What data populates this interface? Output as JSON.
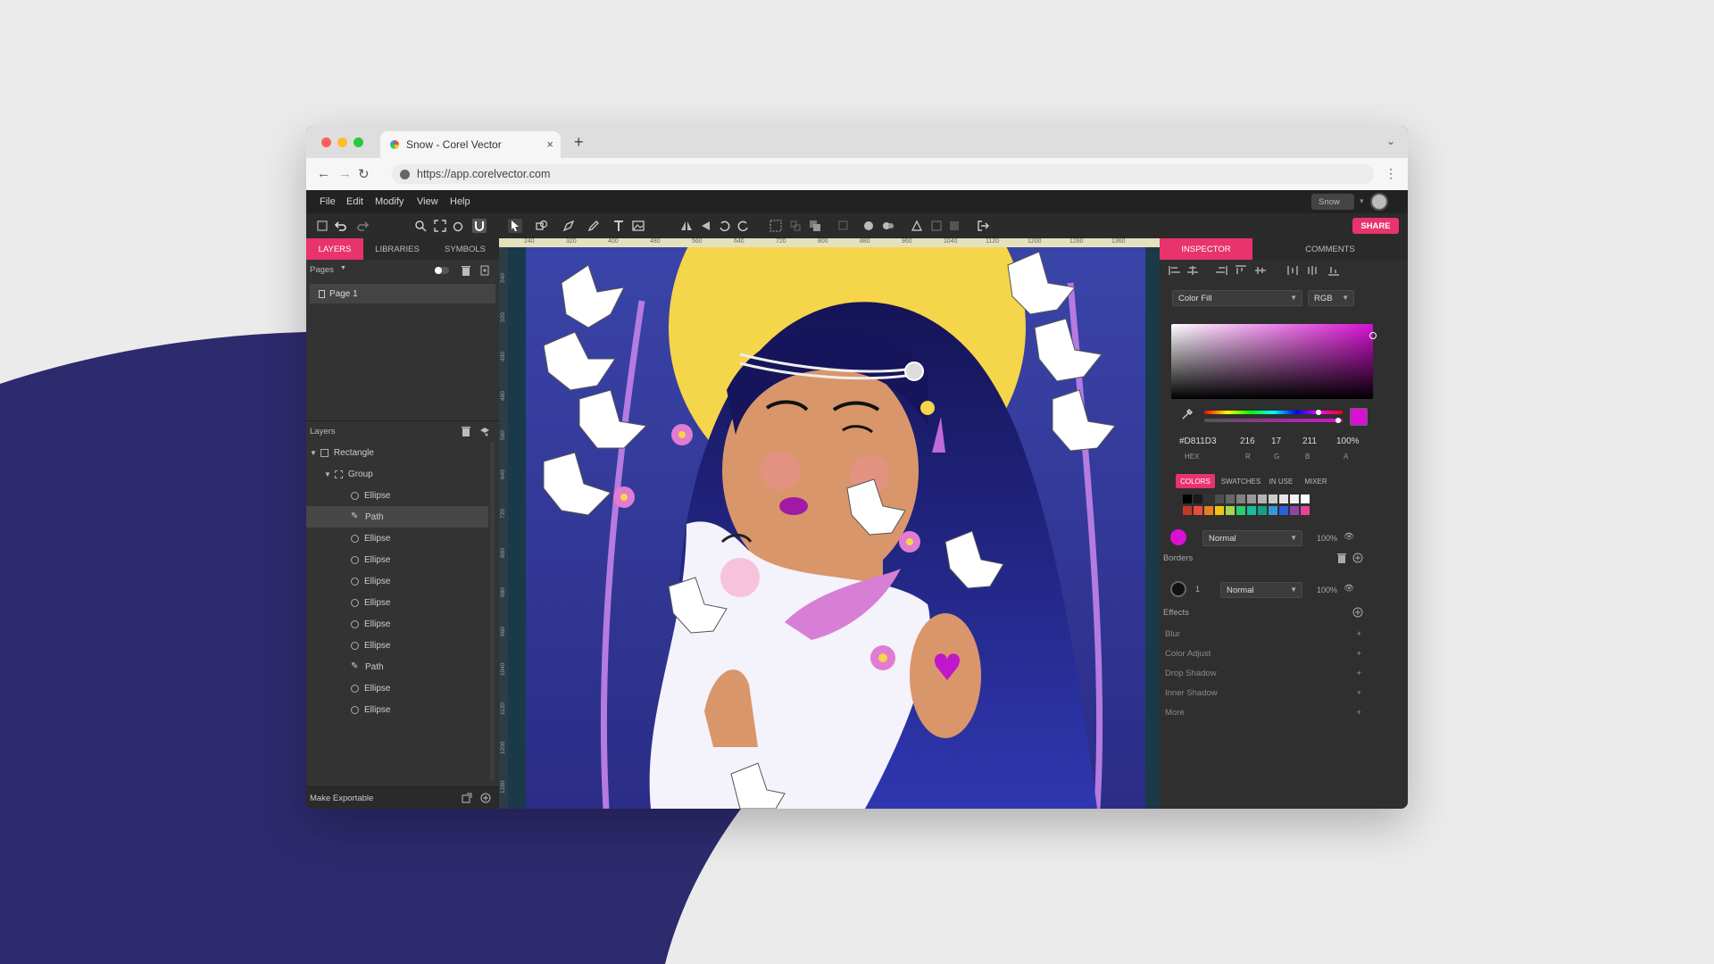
{
  "browser": {
    "tab_title": "Snow - Corel Vector",
    "url": "https://app.corelvector.com",
    "tab_close": "×",
    "new_tab": "+"
  },
  "menu": [
    "File",
    "Edit",
    "Modify",
    "View",
    "Help"
  ],
  "user": {
    "name": "Snow"
  },
  "toolbar": {
    "share_label": "SHARE"
  },
  "left_panel": {
    "tabs": [
      "LAYERS",
      "LIBRARIES",
      "SYMBOLS"
    ],
    "pages_label": "Pages",
    "page_item": "Page 1",
    "layers_label": "Layers",
    "layers": [
      {
        "name": "Rectangle",
        "type": "rect",
        "indent": 0,
        "expanded": true
      },
      {
        "name": "Group",
        "type": "group",
        "indent": 1,
        "expanded": true
      },
      {
        "name": "Ellipse",
        "type": "ellipse",
        "indent": 2
      },
      {
        "name": "Path",
        "type": "path",
        "indent": 2,
        "selected": true
      },
      {
        "name": "Ellipse",
        "type": "ellipse",
        "indent": 2
      },
      {
        "name": "Ellipse",
        "type": "ellipse",
        "indent": 2
      },
      {
        "name": "Ellipse",
        "type": "ellipse",
        "indent": 2
      },
      {
        "name": "Ellipse",
        "type": "ellipse",
        "indent": 2
      },
      {
        "name": "Ellipse",
        "type": "ellipse",
        "indent": 2
      },
      {
        "name": "Ellipse",
        "type": "ellipse",
        "indent": 2
      },
      {
        "name": "Path",
        "type": "path",
        "indent": 2
      },
      {
        "name": "Ellipse",
        "type": "ellipse",
        "indent": 2
      },
      {
        "name": "Ellipse",
        "type": "ellipse",
        "indent": 2
      }
    ],
    "bottom_label": "Make Exportable"
  },
  "ruler": {
    "h_ticks": [
      "240",
      "320",
      "400",
      "480",
      "560",
      "640",
      "720",
      "800",
      "880",
      "960",
      "1040",
      "1120",
      "1200",
      "1280",
      "1360"
    ],
    "v_ticks": [
      "240",
      "320",
      "400",
      "480",
      "560",
      "640",
      "720",
      "800",
      "880",
      "960",
      "1040",
      "1120",
      "1200",
      "1280"
    ]
  },
  "inspector": {
    "tabs": [
      "INSPECTOR",
      "COMMENTS"
    ],
    "fill_type": "Color Fill",
    "color_model": "RGB",
    "hex": "#D811D3",
    "r": "216",
    "g": "17",
    "b": "211",
    "a": "100%",
    "labels": [
      "HEX",
      "R",
      "G",
      "B",
      "A"
    ],
    "color_tabs": [
      "COLORS",
      "SWATCHES",
      "IN USE",
      "MIXER"
    ],
    "fill_blend": "Normal",
    "fill_opacity": "100%",
    "borders_label": "Borders",
    "border_width": "1",
    "border_blend": "Normal",
    "border_opacity": "100%",
    "effects_label": "Effects",
    "effects": [
      "Blur",
      "Color Adjust",
      "Drop Shadow",
      "Inner Shadow",
      "More"
    ]
  },
  "colors": {
    "accent": "#e8336c",
    "current_fill": "#d811d3",
    "background_blob": "#2e2a6e",
    "swatches_row1": [
      "#000000",
      "#1a1a1a",
      "#333333",
      "#4d4d4d",
      "#666666",
      "#808080",
      "#999999",
      "#b3b3b3",
      "#cccccc",
      "#e6e6e6",
      "#f2f2f2",
      "#ffffff"
    ],
    "swatches_row2": [
      "#c0392b",
      "#e74c3c",
      "#e67e22",
      "#f1c40f",
      "#a3d94a",
      "#2ecc71",
      "#1abc9c",
      "#16a085",
      "#3498db",
      "#2c5fd8",
      "#8e44ad",
      "#e84393"
    ]
  }
}
